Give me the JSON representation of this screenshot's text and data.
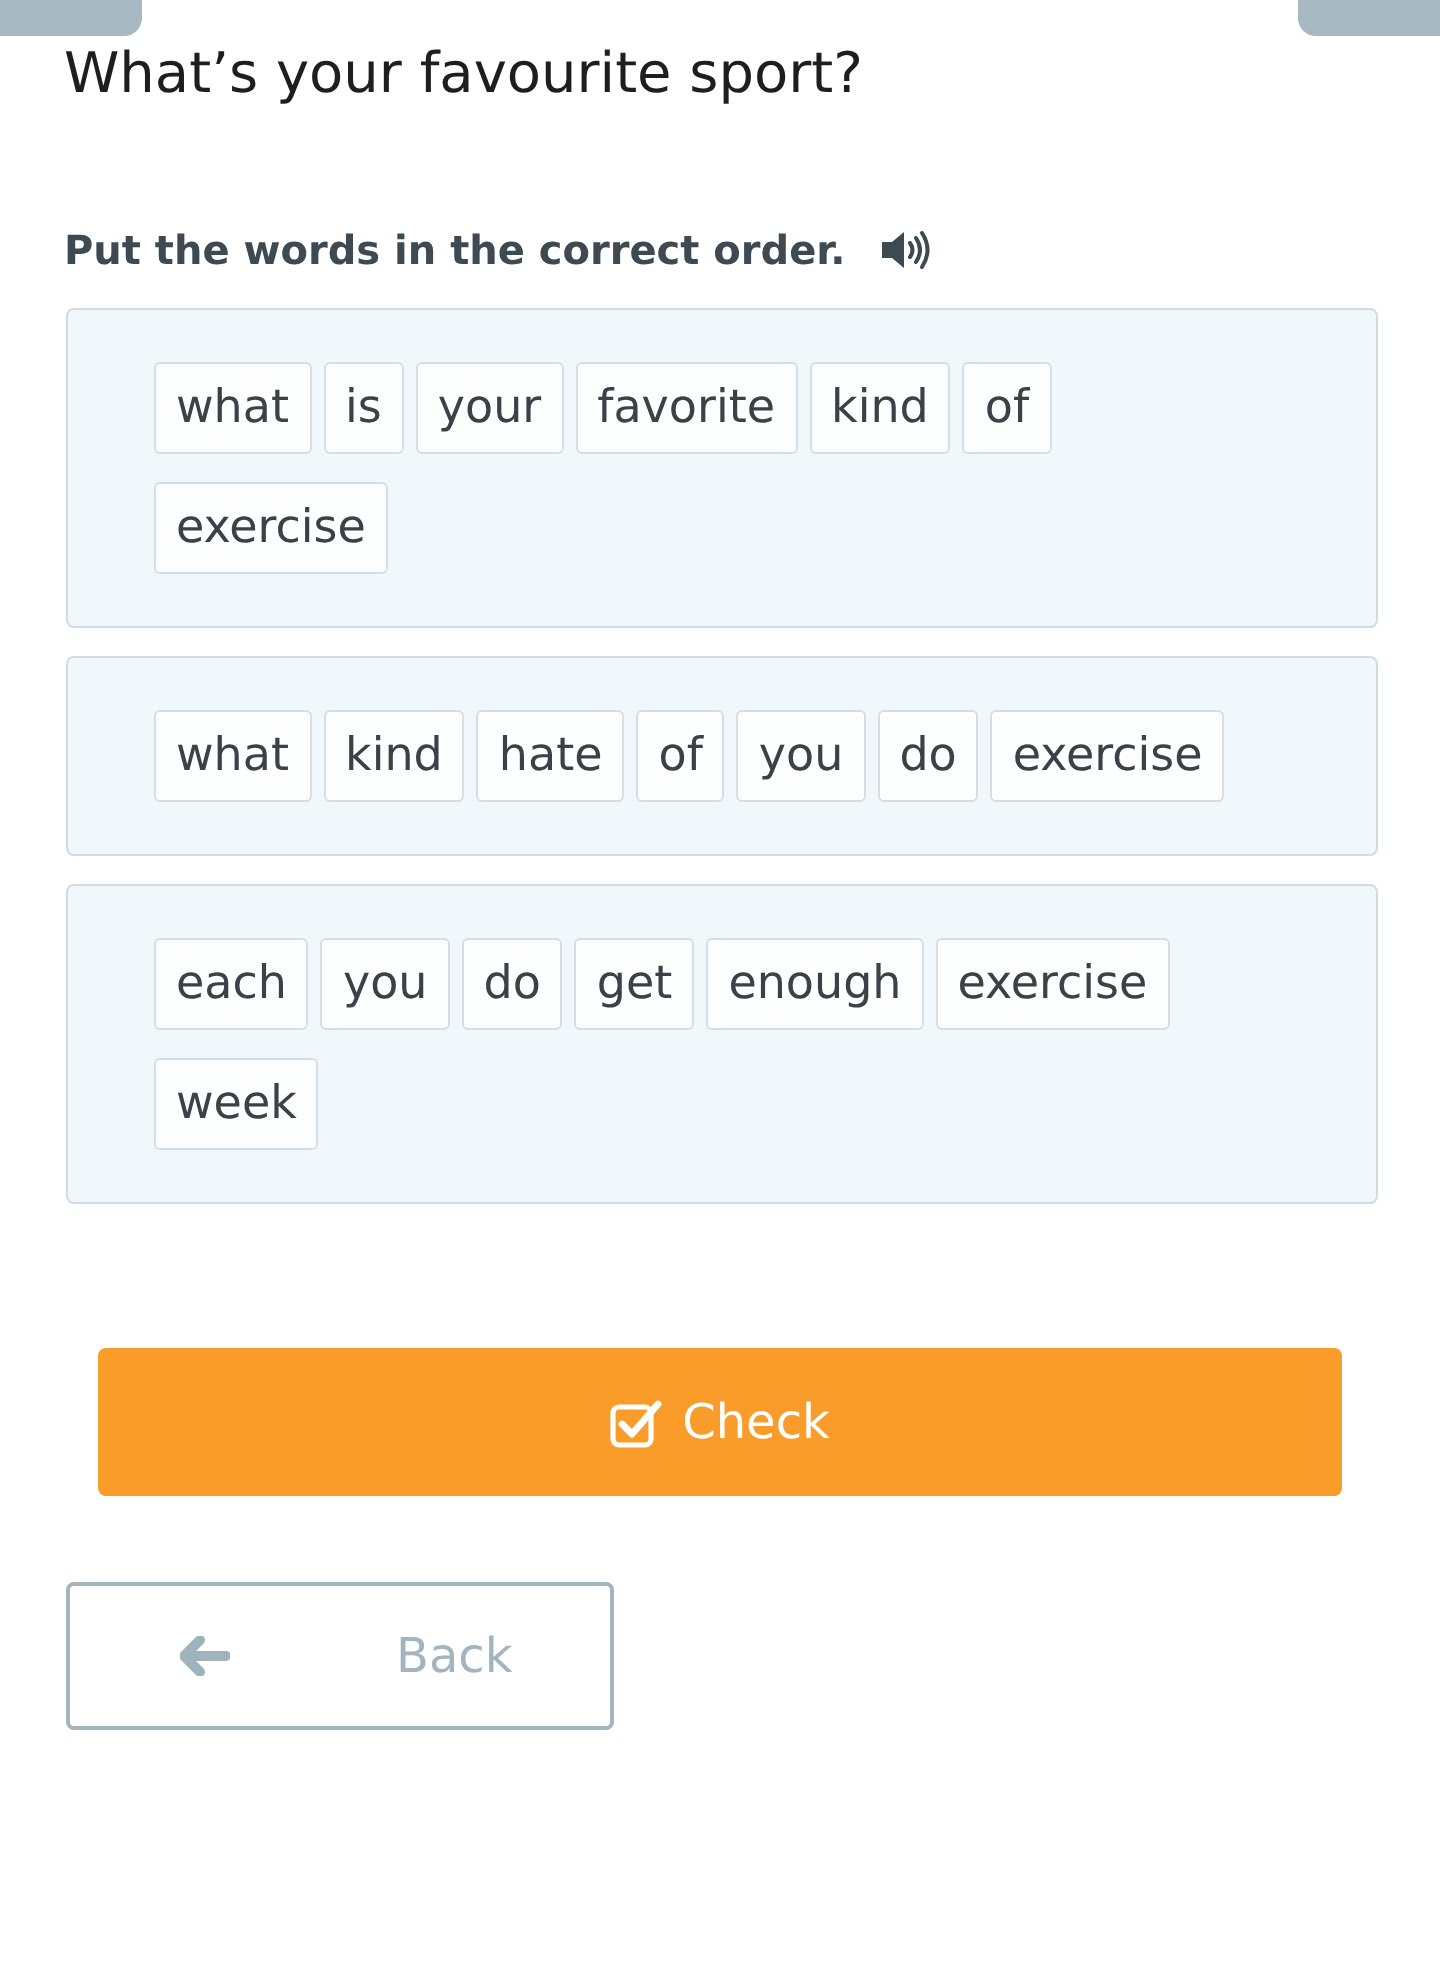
{
  "title": "What’s your favourite sport?",
  "instruction": "Put the words in the correct order.",
  "sentences": [
    {
      "words": [
        "what",
        "is",
        "your",
        "favorite",
        "kind",
        "of",
        "exercise"
      ]
    },
    {
      "words": [
        "what",
        "kind",
        "hate",
        "of",
        "you",
        "do",
        "exercise"
      ]
    },
    {
      "words": [
        "each",
        "you",
        "do",
        "get",
        "enough",
        "exercise",
        "week"
      ]
    }
  ],
  "buttons": [
    {
      "kind": "check",
      "label": "Check"
    },
    {
      "kind": "back",
      "label": "Back"
    }
  ]
}
